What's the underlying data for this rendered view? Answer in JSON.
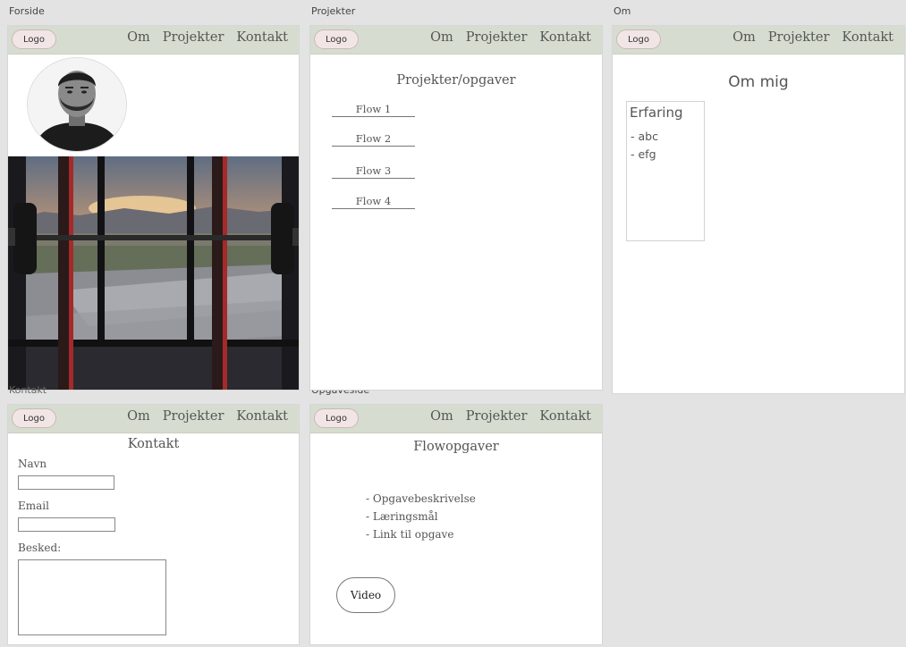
{
  "labels": {
    "forside": "Forside",
    "projekter": "Projekter",
    "om": "Om",
    "kontakt": "Kontakt",
    "opgaveside": "Opgaveside"
  },
  "nav": {
    "logo": "Logo",
    "items": [
      "Om",
      "Projekter",
      "Kontakt"
    ]
  },
  "projekter": {
    "title": "Projekter/opgaver",
    "flows": [
      "Flow 1",
      "Flow 2",
      "Flow 3",
      "Flow 4"
    ]
  },
  "om": {
    "title": "Om mig",
    "experience_title": "Erfaring",
    "experience_items": [
      "- abc",
      "- efg"
    ]
  },
  "kontakt": {
    "title": "Kontakt",
    "name_label": "Navn",
    "email_label": "Email",
    "message_label": "Besked:"
  },
  "opgaveside": {
    "title": "Flowopgaver",
    "items": [
      "- Opgavebeskrivelse",
      "- Læringsmål",
      "- Link til opgave"
    ],
    "video_label": "Video"
  },
  "images": {
    "profile_photo": "profile-photo",
    "gym_photo": "gym-window-photo"
  }
}
